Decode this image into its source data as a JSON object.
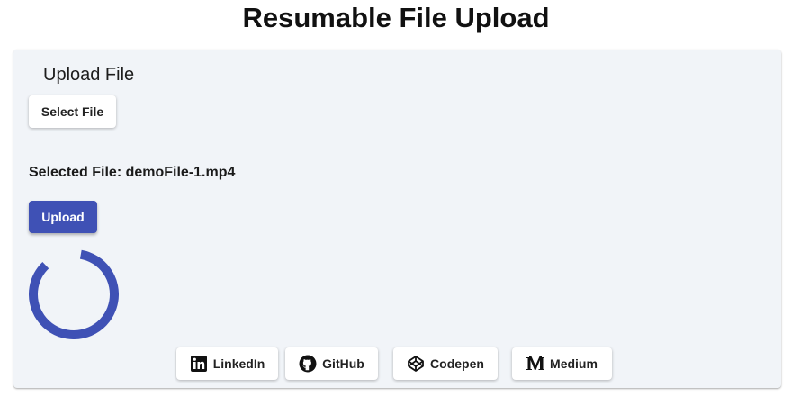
{
  "page": {
    "title": "Resumable File Upload"
  },
  "upload_card": {
    "title": "Upload File",
    "select_button_label": "Select File",
    "selected_file_label": "Selected File: demoFile-1.mp4",
    "upload_button_label": "Upload",
    "spinner_color": "#3f51b5"
  },
  "footer": {
    "links": [
      {
        "label": "LinkedIn",
        "icon": "linkedin-icon"
      },
      {
        "label": "GitHub",
        "icon": "github-icon"
      },
      {
        "label": "Codepen",
        "icon": "codepen-icon"
      },
      {
        "label": "Medium",
        "icon": "medium-icon"
      }
    ]
  },
  "colors": {
    "primary": "#3f51b5",
    "card_background": "#f1f4f8"
  }
}
